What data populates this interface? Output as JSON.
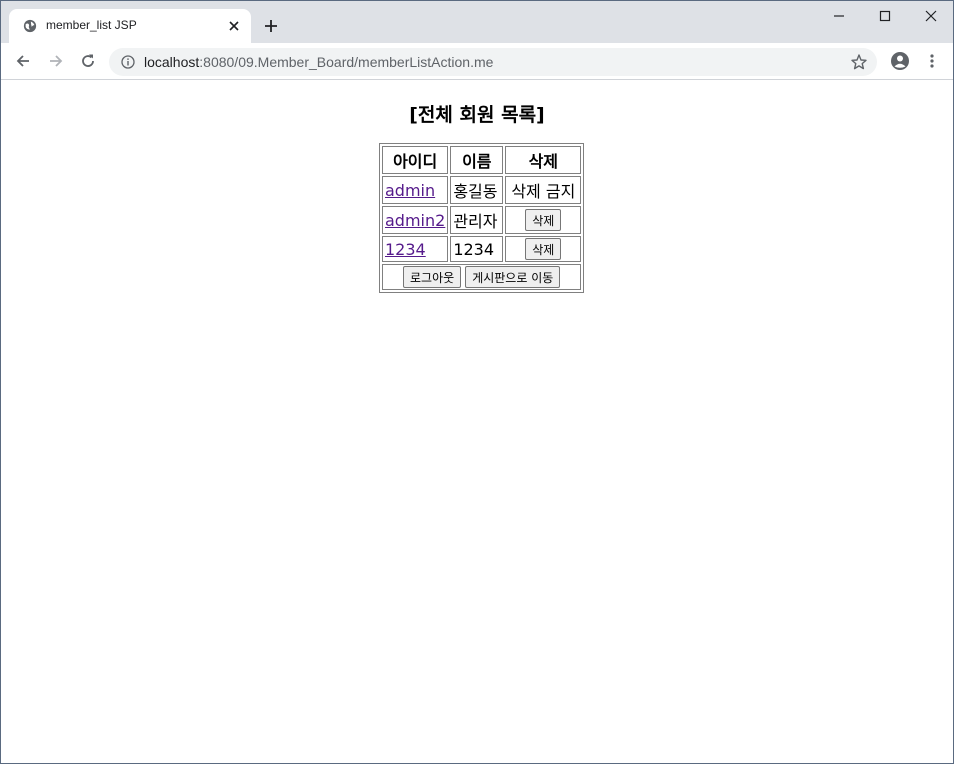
{
  "browser": {
    "tab_title": "member_list JSP",
    "url_host": "localhost",
    "url_rest": ":8080/09.Member_Board/memberListAction.me"
  },
  "page": {
    "title": "[전체 회원 목록]"
  },
  "table": {
    "headers": {
      "id": "아이디",
      "name": "이름",
      "delete": "삭제"
    },
    "rows": [
      {
        "id": "admin",
        "name": "홍길동",
        "delete": "삭제 금지"
      },
      {
        "id": "admin2",
        "name": "관리자",
        "delete": "삭제"
      },
      {
        "id": "1234",
        "name": "1234",
        "delete": "삭제"
      }
    ],
    "logout_label": "로그아웃",
    "board_label": "게시판으로 이동"
  },
  "colors": {
    "link_visited": "#551a8b",
    "tabbar_bg": "#dee1e6"
  }
}
